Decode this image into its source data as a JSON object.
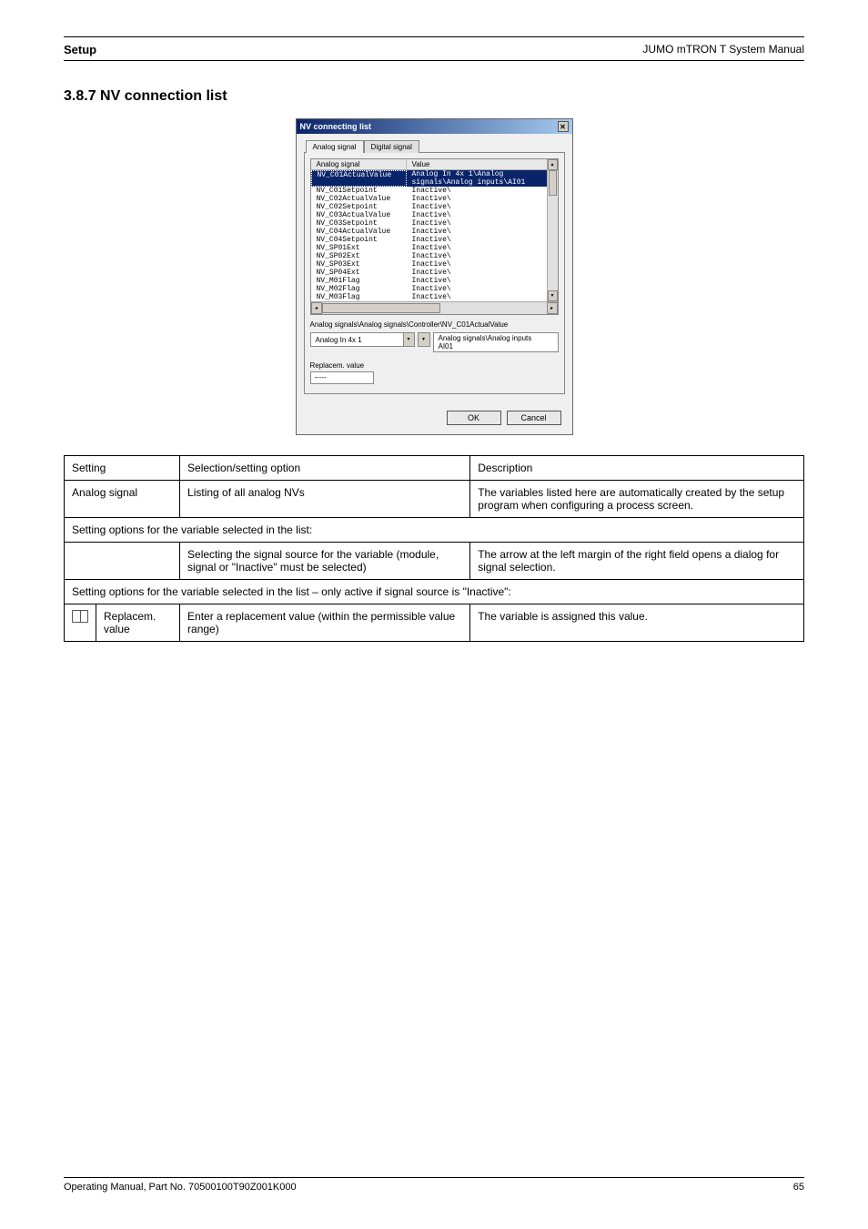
{
  "header": {
    "title": "Setup",
    "doc": "JUMO mTRON T System Manual"
  },
  "section": "3.8.7   NV connection list",
  "dialog": {
    "title": "NV connecting list",
    "tabs": {
      "analog": "Analog signal",
      "digital": "Digital signal"
    },
    "columns": {
      "name": "Analog signal",
      "value": "Value"
    },
    "rows": [
      {
        "n": "NV_C01ActualValue",
        "v": "Analog In 4x 1\\Analog signals\\Analog inputs\\AI01",
        "sel": true
      },
      {
        "n": "NV_C01Setpoint",
        "v": "Inactive\\"
      },
      {
        "n": "NV_C02ActualValue",
        "v": "Inactive\\"
      },
      {
        "n": "NV_C02Setpoint",
        "v": "Inactive\\"
      },
      {
        "n": "NV_C03ActualValue",
        "v": "Inactive\\"
      },
      {
        "n": "NV_C03Setpoint",
        "v": "Inactive\\"
      },
      {
        "n": "NV_C04ActualValue",
        "v": "Inactive\\"
      },
      {
        "n": "NV_C04Setpoint",
        "v": "Inactive\\"
      },
      {
        "n": "NV_SP01Ext",
        "v": "Inactive\\"
      },
      {
        "n": "NV_SP02Ext",
        "v": "Inactive\\"
      },
      {
        "n": "NV_SP03Ext",
        "v": "Inactive\\"
      },
      {
        "n": "NV_SP04Ext",
        "v": "Inactive\\"
      },
      {
        "n": "NV_M01Flag",
        "v": "Inactive\\"
      },
      {
        "n": "NV_M02Flag",
        "v": "Inactive\\"
      },
      {
        "n": "NV_M03Flag",
        "v": "Inactive\\"
      }
    ],
    "path": "Analog signals\\Analog signals\\Controller\\NV_C01ActualValue",
    "combo1": "Analog In 4x 1",
    "combo2": "Analog signals\\Analog inputs\nAI01",
    "repl_label": "Replacem. value",
    "repl_value": "-----",
    "ok": "OK",
    "cancel": "Cancel"
  },
  "table": {
    "head": {
      "c1": "Setting",
      "c2": "Selection/setting option",
      "c3": "Description"
    },
    "r1": {
      "c1": "Analog signal",
      "c2": "Listing of all analog NVs",
      "c3": "The variables listed here are automatically created by the setup program when configuring a process screen."
    },
    "r2": "Setting options for the variable selected in the list:",
    "r3": {
      "c2": "Selecting the signal source for the variable (module, signal or \"Inactive\" must be selected)",
      "c3": "The arrow at the left margin of the right field opens a dialog for signal selection."
    },
    "r4": "Setting options for the variable selected in the list – only active if signal source is \"Inactive\":",
    "r5": {
      "c1": "Replacem. value",
      "c2": "Enter a replacement value (within the permissible value range)",
      "c3": "The variable is assigned this value."
    }
  },
  "footer": {
    "left": "Operating Manual, Part No. 70500100T90Z001K000",
    "right": "65"
  }
}
